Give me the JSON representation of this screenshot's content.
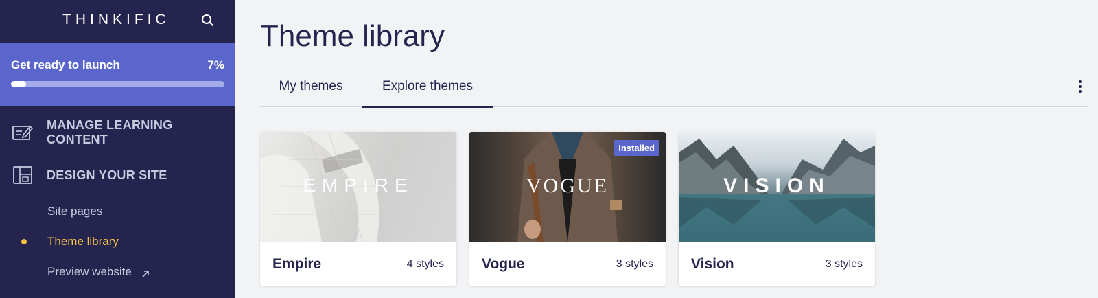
{
  "sidebar": {
    "logo": "THINKIFIC",
    "launch": {
      "label": "Get ready to launch",
      "percent_label": "7%",
      "progress": 0.07
    },
    "sections": [
      {
        "label": "MANAGE LEARNING CONTENT",
        "icon": "edit-list-icon"
      },
      {
        "label": "DESIGN YOUR SITE",
        "icon": "layout-icon"
      }
    ],
    "sub_items": [
      {
        "label": "Site pages",
        "active": false
      },
      {
        "label": "Theme library",
        "active": true
      },
      {
        "label": "Preview website",
        "active": false,
        "icon": "external-arrow-icon"
      }
    ]
  },
  "main": {
    "title": "Theme library",
    "tabs": [
      {
        "label": "My themes",
        "active": false
      },
      {
        "label": "Explore themes",
        "active": true
      }
    ],
    "themes": [
      {
        "name": "Empire",
        "styles": "4 styles",
        "thumb_text": "EMPIRE",
        "badge": ""
      },
      {
        "name": "Vogue",
        "styles": "3 styles",
        "thumb_text": "VOGUE",
        "badge": "Installed"
      },
      {
        "name": "Vision",
        "styles": "3 styles",
        "thumb_text": "VISION",
        "badge": ""
      }
    ]
  },
  "colors": {
    "sidebar_bg": "#24244f",
    "accent": "#5b66cc",
    "active_item": "#f6c244",
    "page_bg": "#f2f3f5"
  }
}
